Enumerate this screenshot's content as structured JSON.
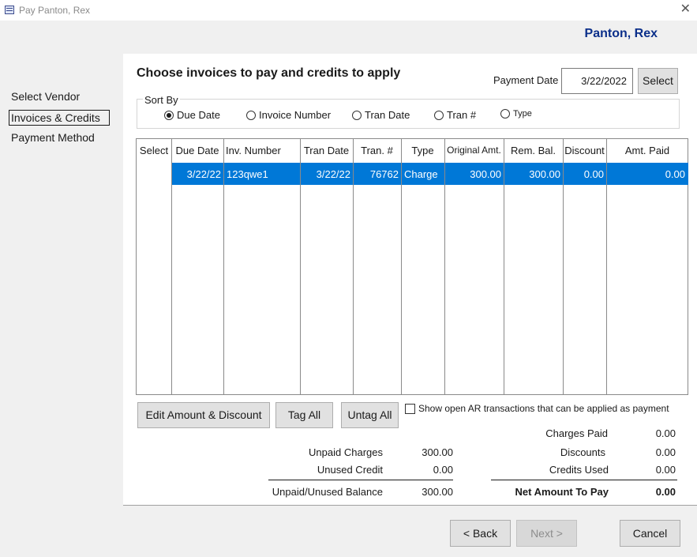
{
  "window": {
    "title": "Pay Panton, Rex"
  },
  "vendor_name": "Panton, Rex",
  "nav": {
    "items": [
      {
        "label": "Select Vendor"
      },
      {
        "label": "Invoices & Credits"
      },
      {
        "label": "Payment Method"
      }
    ]
  },
  "heading": "Choose invoices to pay and credits to apply",
  "payment_date": {
    "label": "Payment Date",
    "value": "3/22/2022",
    "select_label": "Select"
  },
  "sort_by": {
    "label": "Sort By",
    "options": [
      "Due Date",
      "Invoice Number",
      "Tran Date",
      "Tran #",
      "Type"
    ],
    "selected": "Due Date"
  },
  "table": {
    "columns": [
      "Select",
      "Due Date",
      "Inv. Number",
      "Tran Date",
      "Tran. #",
      "Type",
      "Original Amt.",
      "Rem. Bal.",
      "Discount",
      "Amt. Paid"
    ],
    "rows": [
      {
        "select": "",
        "due_date": "3/22/22",
        "inv_number": "123qwe1",
        "tran_date": "3/22/22",
        "tran_no": "76762",
        "type": "Charge",
        "original_amt": "300.00",
        "rem_bal": "300.00",
        "discount": "0.00",
        "amt_paid": "0.00"
      }
    ]
  },
  "buttons": {
    "edit_amount": "Edit Amount & Discount",
    "tag_all": "Tag All",
    "untag_all": "Untag All",
    "back": "< Back",
    "next": "Next >",
    "cancel": "Cancel"
  },
  "show_open_ar": {
    "label": "Show open AR transactions that can be applied as payment",
    "checked": false
  },
  "summary_left": {
    "unpaid_charges_label": "Unpaid Charges",
    "unpaid_charges": "300.00",
    "unused_credit_label": "Unused Credit",
    "unused_credit": "0.00",
    "balance_label": "Unpaid/Unused Balance",
    "balance": "300.00"
  },
  "summary_right": {
    "charges_paid_label": "Charges Paid",
    "charges_paid": "0.00",
    "discounts_label": "Discounts",
    "discounts": "0.00",
    "credits_used_label": "Credits Used",
    "credits_used": "0.00",
    "net_label": "Net Amount To Pay",
    "net": "0.00"
  },
  "colors": {
    "selection": "#0078d7",
    "vendor_name": "#0b2f8a"
  }
}
